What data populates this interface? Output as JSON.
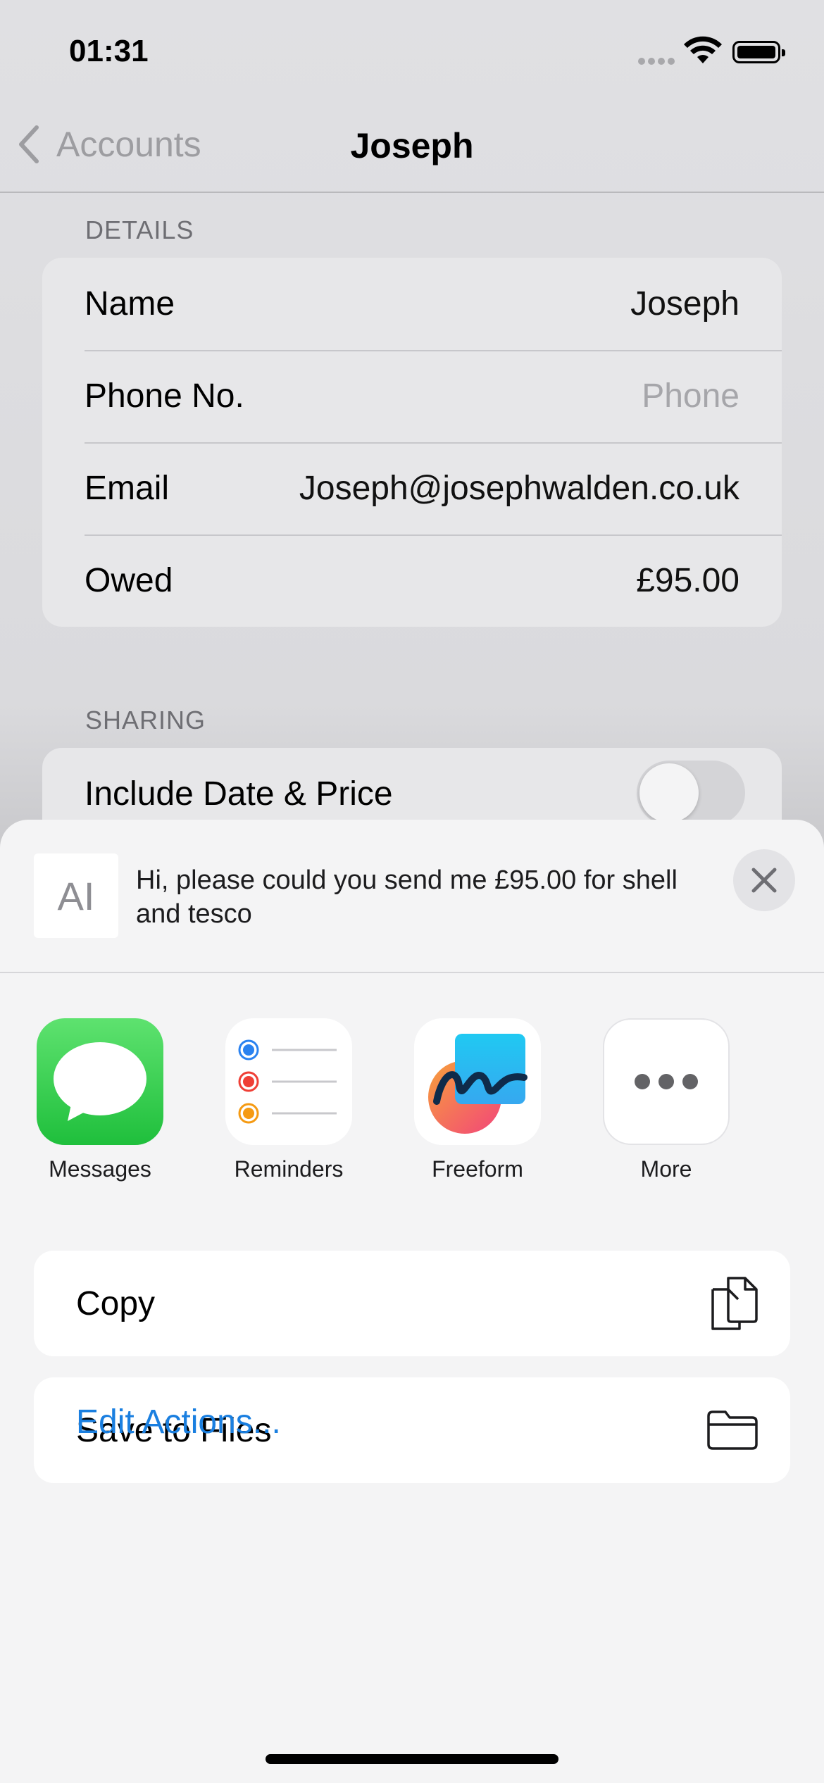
{
  "status_bar": {
    "time": "01:31"
  },
  "nav": {
    "back_label": "Accounts",
    "title": "Joseph"
  },
  "details": {
    "header": "DETAILS",
    "rows": [
      {
        "label": "Name",
        "value": "Joseph"
      },
      {
        "label": "Phone No.",
        "placeholder": "Phone"
      },
      {
        "label": "Email",
        "value": "Joseph@josephwalden.co.uk"
      },
      {
        "label": "Owed",
        "value": "£95.00"
      }
    ]
  },
  "sharing": {
    "header": "SHARING",
    "toggle_label": "Include Date & Price",
    "toggle_on": false
  },
  "share_sheet": {
    "preview_glyph": "AI",
    "preview_text": "Hi, please could you send me £95.00 for shell and tesco",
    "apps": [
      {
        "label": "Messages",
        "icon": "messages-app-icon"
      },
      {
        "label": "Reminders",
        "icon": "reminders-app-icon"
      },
      {
        "label": "Freeform",
        "icon": "freeform-app-icon"
      },
      {
        "label": "More",
        "icon": "more-icon"
      }
    ],
    "actions": [
      {
        "label": "Copy",
        "icon": "copy-icon"
      },
      {
        "label": "Save to Files",
        "icon": "folder-icon"
      }
    ],
    "edit_actions": "Edit Actions..."
  },
  "colors": {
    "accent": "#1a7fe0",
    "messages_green": "#32c759"
  }
}
